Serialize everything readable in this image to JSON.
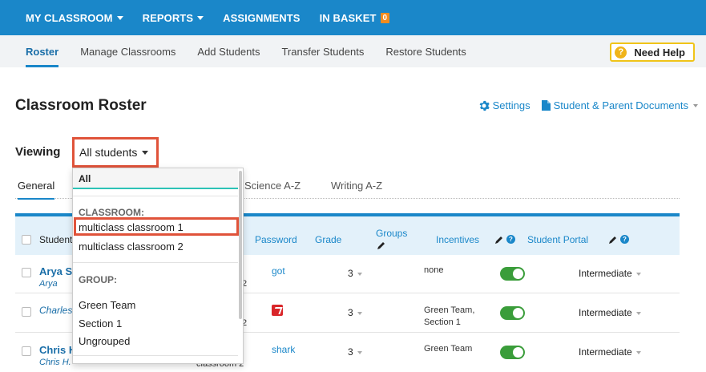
{
  "topnav": {
    "items": [
      {
        "label": "MY CLASSROOM",
        "has_caret": true
      },
      {
        "label": "REPORTS",
        "has_caret": true
      },
      {
        "label": "ASSIGNMENTS",
        "has_caret": false
      },
      {
        "label": "IN BASKET",
        "has_caret": false
      }
    ],
    "in_basket_count": "0"
  },
  "subnav": {
    "items": [
      "Roster",
      "Manage Classrooms",
      "Add Students",
      "Transfer Students",
      "Restore Students"
    ],
    "active": "Roster",
    "help_label": "Need Help",
    "help_icon": "?"
  },
  "page": {
    "title": "Classroom Roster",
    "settings_label": "Settings",
    "documents_label": "Student & Parent Documents"
  },
  "viewing": {
    "label": "Viewing",
    "selected": "All students"
  },
  "tabs": [
    "General",
    "Science A-Z",
    "Writing A-Z"
  ],
  "dropdown": {
    "all_label": "All",
    "classroom_header": "CLASSROOM:",
    "classrooms": [
      "multiclass classroom 1",
      "multiclass classroom 2"
    ],
    "group_header": "GROUP:",
    "groups": [
      "Green Team",
      "Section 1",
      "Ungrouped"
    ]
  },
  "table": {
    "headers": {
      "student": "Student",
      "password": "Password",
      "grade": "Grade",
      "groups": "Groups",
      "incentives": "Incentives",
      "student_portal": "Student Portal"
    },
    "rows": [
      {
        "name": "Arya St",
        "username": "Arya",
        "class_fragment": "2",
        "password": "got",
        "grade": "3",
        "groups": "none",
        "portal": "Intermediate"
      },
      {
        "name": "",
        "username": "Charles",
        "class_fragment": "2",
        "password": "",
        "grade": "3",
        "groups": "Green Team, Section 1",
        "portal": "Intermediate"
      },
      {
        "name": "Chris H",
        "username": "Chris H.",
        "class_fragment": "classroom 2",
        "password": "shark",
        "grade": "3",
        "groups": "Green Team",
        "portal": "Intermediate"
      }
    ]
  },
  "colors": {
    "nav_blue": "#1a87c9",
    "highlight_red": "#e0533a",
    "badge_orange": "#f28c1e",
    "toggle_green": "#3a9d3a",
    "help_yellow": "#f0c419"
  }
}
